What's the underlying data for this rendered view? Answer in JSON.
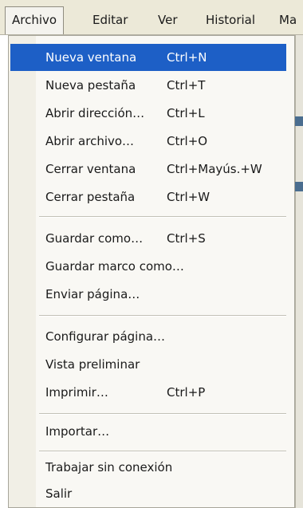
{
  "menubar": {
    "items": [
      {
        "label": "Archivo",
        "active": true
      },
      {
        "label": "Editar"
      },
      {
        "label": "Ver"
      },
      {
        "label": "Historial"
      },
      {
        "label": "Ma"
      }
    ]
  },
  "menu": {
    "items": [
      {
        "label": "Nueva ventana",
        "shortcut": "Ctrl+N",
        "highlighted": true
      },
      {
        "label": "Nueva pestaña",
        "shortcut": "Ctrl+T"
      },
      {
        "label": "Abrir dirección…",
        "shortcut": "Ctrl+L"
      },
      {
        "label": "Abrir archivo…",
        "shortcut": "Ctrl+O"
      },
      {
        "label": "Cerrar ventana",
        "shortcut": "Ctrl+Mayús.+W"
      },
      {
        "label": "Cerrar pestaña",
        "shortcut": "Ctrl+W"
      },
      {
        "label": "Guardar como…",
        "shortcut": "Ctrl+S"
      },
      {
        "label": "Guardar marco como…",
        "shortcut": ""
      },
      {
        "label": "Enviar página…",
        "shortcut": ""
      },
      {
        "label": "Configurar página…",
        "shortcut": ""
      },
      {
        "label": "Vista preliminar",
        "shortcut": ""
      },
      {
        "label": "Imprimir…",
        "shortcut": "Ctrl+P"
      },
      {
        "label": "Importar…",
        "shortcut": ""
      },
      {
        "label": "Trabajar sin conexión",
        "shortcut": ""
      },
      {
        "label": "Salir",
        "shortcut": ""
      }
    ]
  },
  "colors": {
    "highlight": "#1d5fc6",
    "menubar_bg": "#ece9d8",
    "menu_bg": "#f9f8f4"
  }
}
